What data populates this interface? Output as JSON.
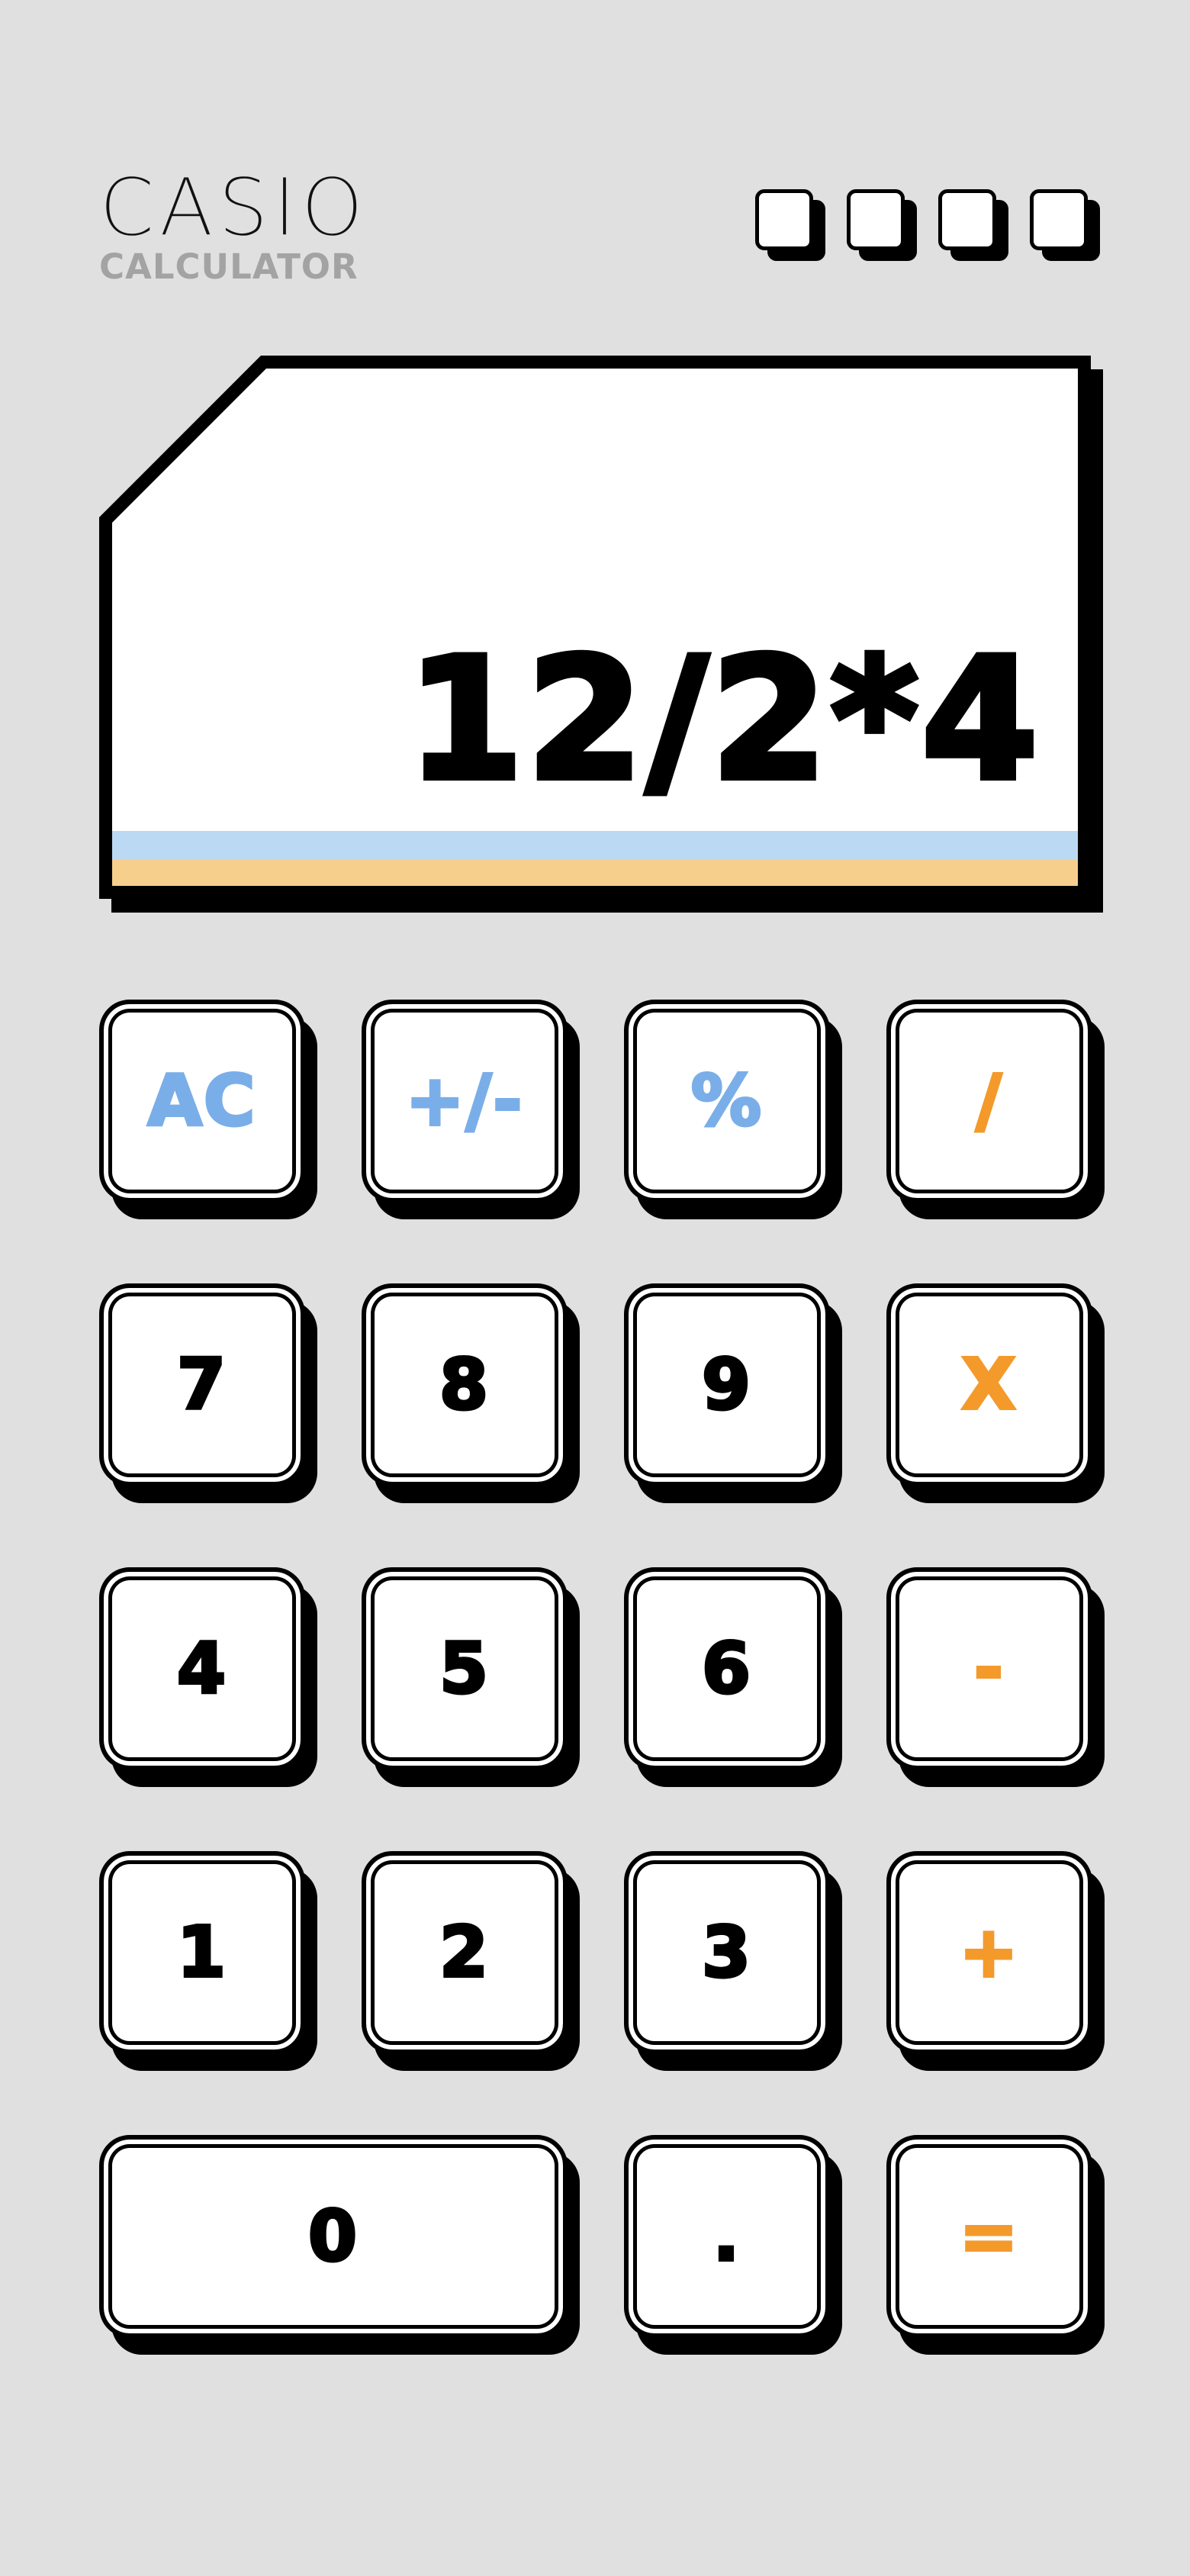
{
  "header": {
    "brand": "CASIO",
    "subtitle": "CALCULATOR"
  },
  "solar_panel_cells": 4,
  "display": {
    "value": "12/2*4",
    "stripe_colors": [
      "#bcd9f3",
      "#f7cf8c"
    ]
  },
  "keys": {
    "ac": "AC",
    "sign": "+/-",
    "percent": "%",
    "divide": "/",
    "seven": "7",
    "eight": "8",
    "nine": "9",
    "multiply": "X",
    "four": "4",
    "five": "5",
    "six": "6",
    "subtract": "-",
    "one": "1",
    "two": "2",
    "three": "3",
    "add": "+",
    "zero": "0",
    "decimal": ".",
    "equals": "="
  },
  "colors": {
    "background": "#e0e0e0",
    "function_key_text": "#7aaee8",
    "operator_key_text": "#f39a2b",
    "digit_key_text": "#000000",
    "subtitle_text": "#a3a3a3"
  }
}
